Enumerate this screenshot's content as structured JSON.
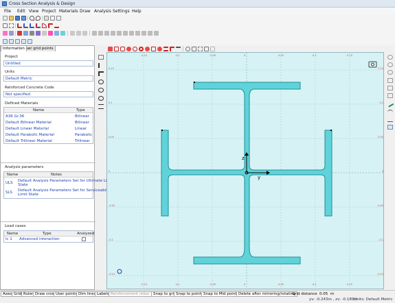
{
  "window": {
    "title": "Cross Section Analysis & Design"
  },
  "menu": [
    "File",
    "Edit",
    "View",
    "Project",
    "Materials",
    "Draw",
    "Analysis",
    "Settings",
    "Help"
  ],
  "tabs": [
    {
      "label": "Information",
      "active": true
    },
    {
      "label": "User grid points",
      "active": false
    }
  ],
  "info": {
    "project_label": "Project",
    "project_value": "Untitled",
    "units_label": "Units",
    "units_value": "Default Metric",
    "code_label": "Reinforced Concrete Code",
    "code_value": "Not specified"
  },
  "materials": {
    "label": "Defined Materials",
    "headers": [
      "Name",
      "Type"
    ],
    "rows": [
      {
        "name": "A36 Gr.36",
        "type": "Bilinear"
      },
      {
        "name": "Default Bilinear Material",
        "type": "Bilinear"
      },
      {
        "name": "Default Linear Material",
        "type": "Linear"
      },
      {
        "name": "Default Parabolic Material",
        "type": "Parabolic"
      },
      {
        "name": "Default Trilinear Material",
        "type": "Trilinear"
      }
    ]
  },
  "analysis": {
    "label": "Analysis parameters",
    "headers": [
      "Name",
      "Notes"
    ],
    "rows": [
      {
        "name": "ULS",
        "notes_line1": "Default Analysis Parameters Set for Ultimate Limit",
        "notes_line2": "State"
      },
      {
        "name": "SLS",
        "notes_line1": "Default Analysis Parameters Set for Serviceability",
        "notes_line2": "Limit State"
      }
    ]
  },
  "loads": {
    "label": "Load cases",
    "headers": [
      "Name",
      "Type",
      "Analyzed"
    ],
    "rows": [
      {
        "name": "lc 1",
        "type": "Advanced interaction",
        "analyzed": false
      }
    ]
  },
  "canvas": {
    "axis_x": "y",
    "axis_y": "z",
    "x_ticks": [
      "-0.15",
      "-0.1",
      "-0.05",
      "0",
      "0.05",
      "0.1",
      "0.15",
      "0.2",
      "0.25"
    ],
    "y_ticks": [
      "0.25",
      "0.2",
      "0.15",
      "0.1",
      "0.05",
      "0",
      "-0.05",
      "-0.1",
      "-0.15",
      "-0.2",
      "-0.25"
    ],
    "section_color": "#5fd3d9",
    "section_border": "#1f8f97"
  },
  "status": {
    "buttons": [
      {
        "label": "Axes",
        "enabled": true
      },
      {
        "label": "Grid",
        "enabled": true
      },
      {
        "label": "Ruler",
        "enabled": true
      },
      {
        "label": "Draw cross",
        "enabled": true
      },
      {
        "label": "User points",
        "enabled": true
      },
      {
        "label": "Dim lines",
        "enabled": true
      },
      {
        "label": "Labels",
        "enabled": true
      },
      {
        "label": "Reinforcement rebar Nr.",
        "enabled": false
      },
      {
        "label": "Snap to grid",
        "enabled": true
      },
      {
        "label": "Snap to points",
        "enabled": true
      },
      {
        "label": "Snap to Mid points",
        "enabled": true
      }
    ],
    "delete_label": "Delete after mirroring/rotating",
    "grid_distance_label": "Grid distance",
    "grid_distance_value": "0.05",
    "grid_distance_unit": "m",
    "coords": "yv: -0.243m , zv: -0.189m",
    "units_readout": "Units: Default Metric"
  }
}
